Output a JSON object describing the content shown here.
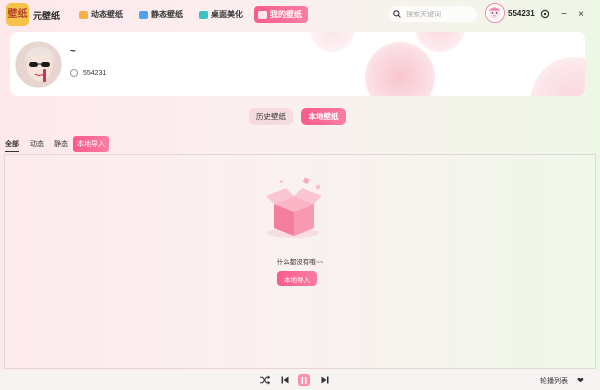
{
  "app": {
    "logo_text": "壁纸",
    "name": "元壁纸"
  },
  "nav": [
    {
      "label": "动态壁纸",
      "icon": "dynamic-wallpaper-icon",
      "color": "#f3b34a"
    },
    {
      "label": "静态壁纸",
      "icon": "static-wallpaper-icon",
      "color": "#4ea3e8"
    },
    {
      "label": "桌面美化",
      "icon": "desktop-beautify-icon",
      "color": "#3cc0c4"
    },
    {
      "label": "我的壁纸",
      "icon": "my-wallpaper-icon",
      "color": "#ffffff",
      "active": true
    }
  ],
  "search": {
    "placeholder": "搜索关键词",
    "value": ""
  },
  "user": {
    "name": "554231"
  },
  "window": {
    "settings": "settings-icon",
    "minimize": "−",
    "close": "×"
  },
  "profile": {
    "nickname": "~",
    "uid": "554231"
  },
  "segments": {
    "history": "历史壁纸",
    "local": "本地壁纸"
  },
  "filters": {
    "all": "全部",
    "dynamic": "动态",
    "static": "静态",
    "import": "本地导入"
  },
  "empty": {
    "message": "什么都没有哦~~",
    "button": "本地导入"
  },
  "player": {
    "playlist": "轮播列表"
  },
  "colors": {
    "accent": "#f85c8b",
    "accent_light": "#f97ea4",
    "logo_bg": "#f6c24a"
  }
}
